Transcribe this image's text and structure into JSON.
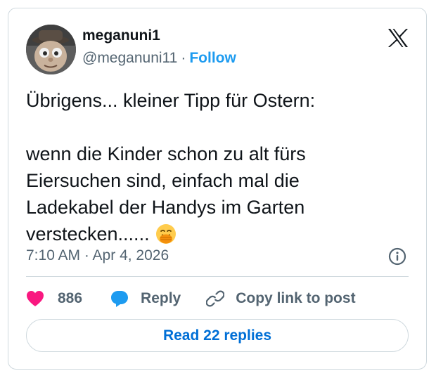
{
  "author": {
    "display_name": "meganuni1",
    "handle": "@meganuni11",
    "separator": "·",
    "follow_label": "Follow"
  },
  "tweet": {
    "line1": "Übrigens... kleiner Tipp für Ostern:",
    "line2": "wenn die Kinder schon zu alt fürs",
    "line3": "Eiersuchen sind, einfach mal die",
    "line4": "Ladekabel der Handys im Garten",
    "line5": "verstecken......",
    "emoji": "face-with-hand-over-mouth"
  },
  "meta": {
    "timestamp": "7:10 AM · Apr 4, 2026"
  },
  "actions": {
    "like_count": "886",
    "reply_label": "Reply",
    "copy_label": "Copy link to post"
  },
  "footer": {
    "read_replies_label": "Read 22 replies"
  },
  "colors": {
    "accent": "#1d9bf0",
    "link_button_text": "#006fd6",
    "like_heart": "#f91880",
    "secondary_text": "#536471",
    "border": "#cfd9de"
  }
}
